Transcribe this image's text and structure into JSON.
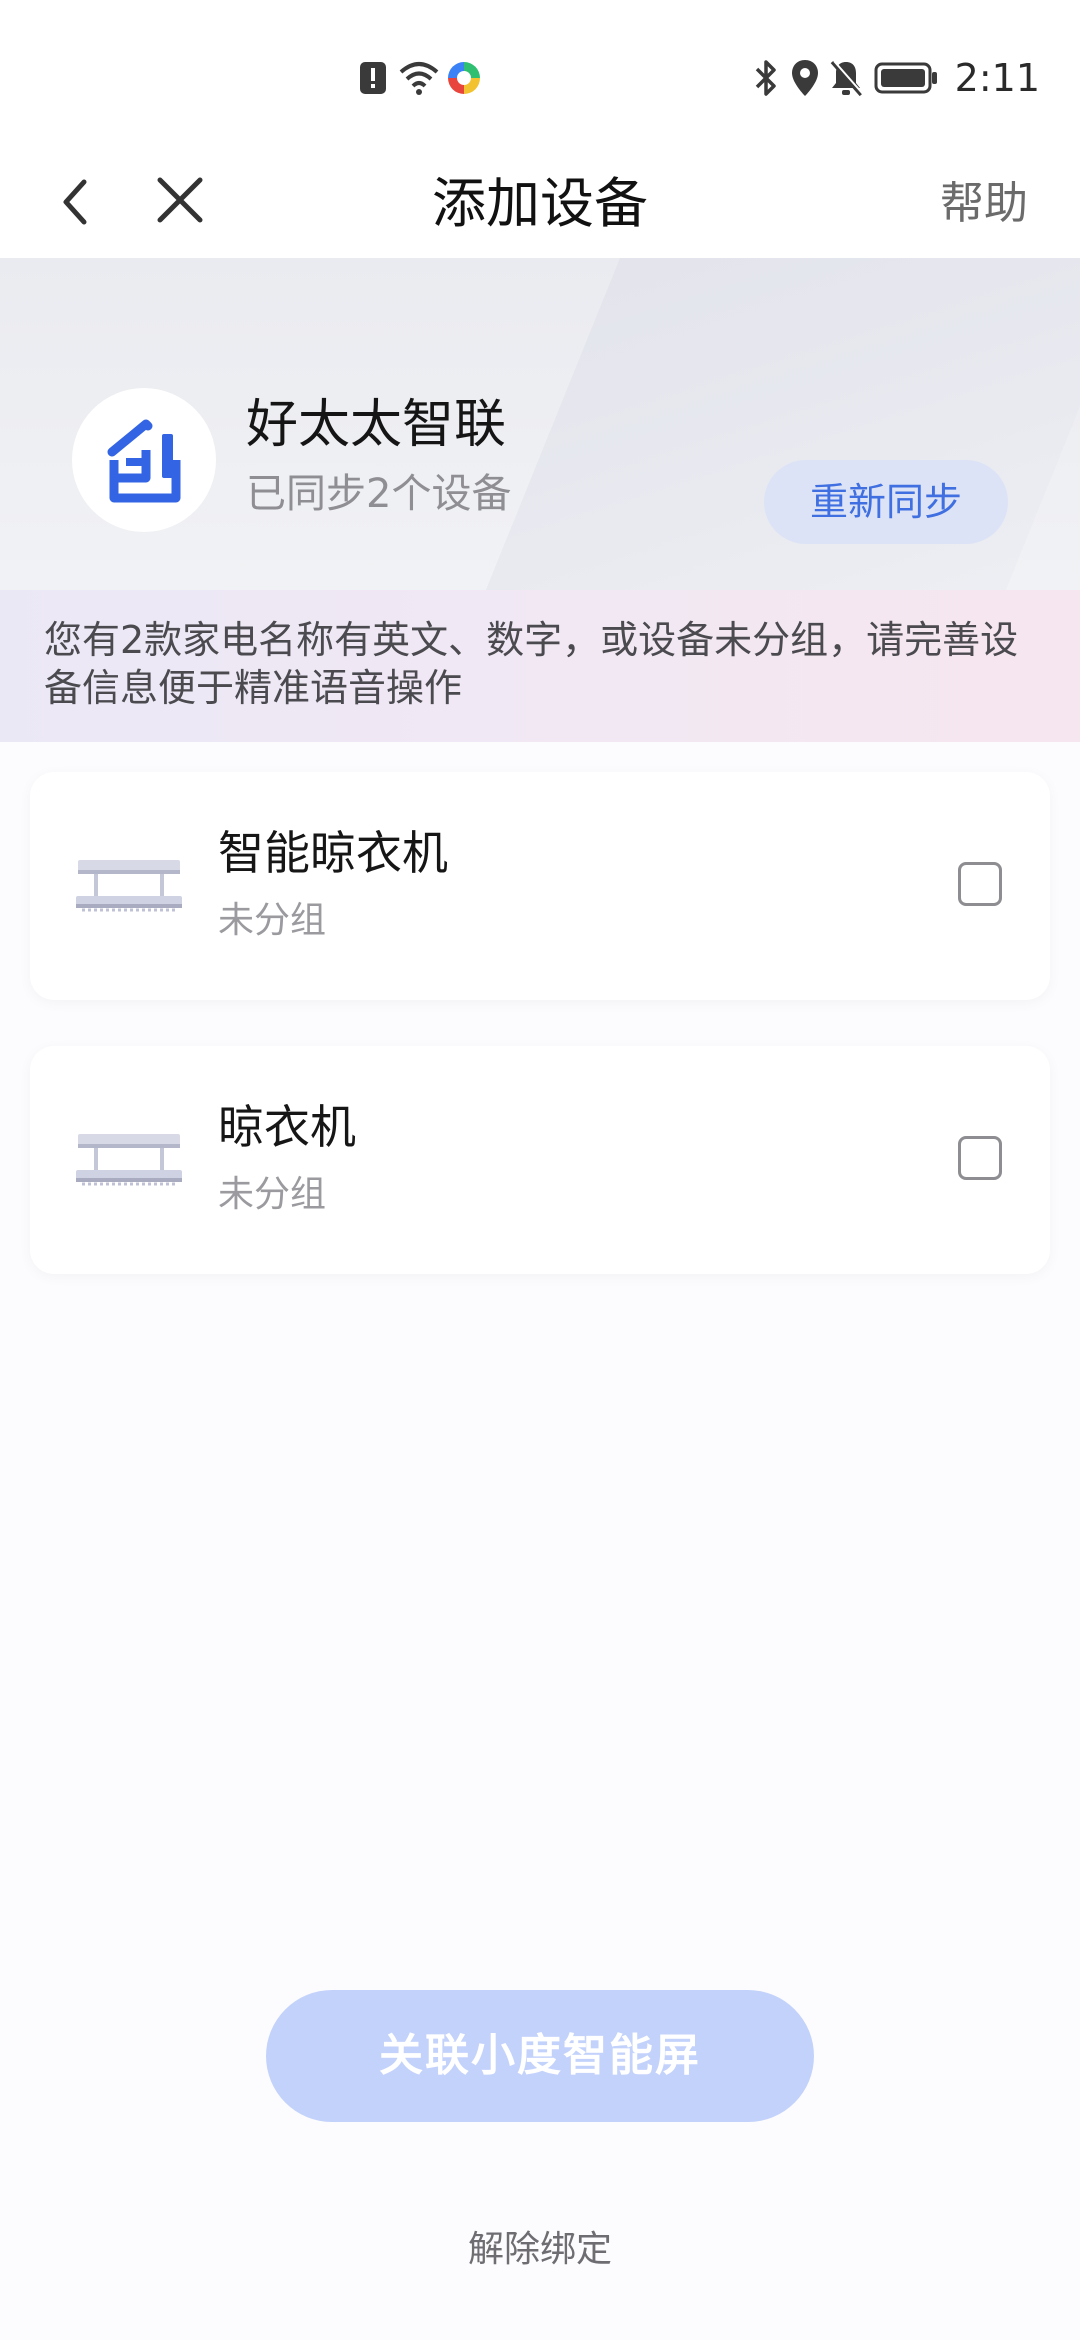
{
  "status_bar": {
    "time": "2:11",
    "left_icons": [
      "alert-icon",
      "wifi-icon",
      "app-notification-icon"
    ],
    "right_icons": [
      "bluetooth-icon",
      "location-icon",
      "mute-icon",
      "battery-icon"
    ]
  },
  "navbar": {
    "title": "添加设备",
    "help_label": "帮助",
    "back_icon": "chevron-left-icon",
    "close_icon": "close-icon"
  },
  "brand": {
    "name": "好太太智联",
    "sync_status": "已同步2个设备",
    "resync_label": "重新同步",
    "accent_color": "#3f6fe0"
  },
  "notice": {
    "text": "您有2款家电名称有英文、数字，或设备未分组，请完善设备信息便于精准语音操作"
  },
  "devices": [
    {
      "name": "智能晾衣机",
      "group": "未分组",
      "checked": false
    },
    {
      "name": "晾衣机",
      "group": "未分组",
      "checked": false
    }
  ],
  "footer": {
    "link_label": "关联小度智能屏",
    "unbind_label": "解除绑定"
  }
}
